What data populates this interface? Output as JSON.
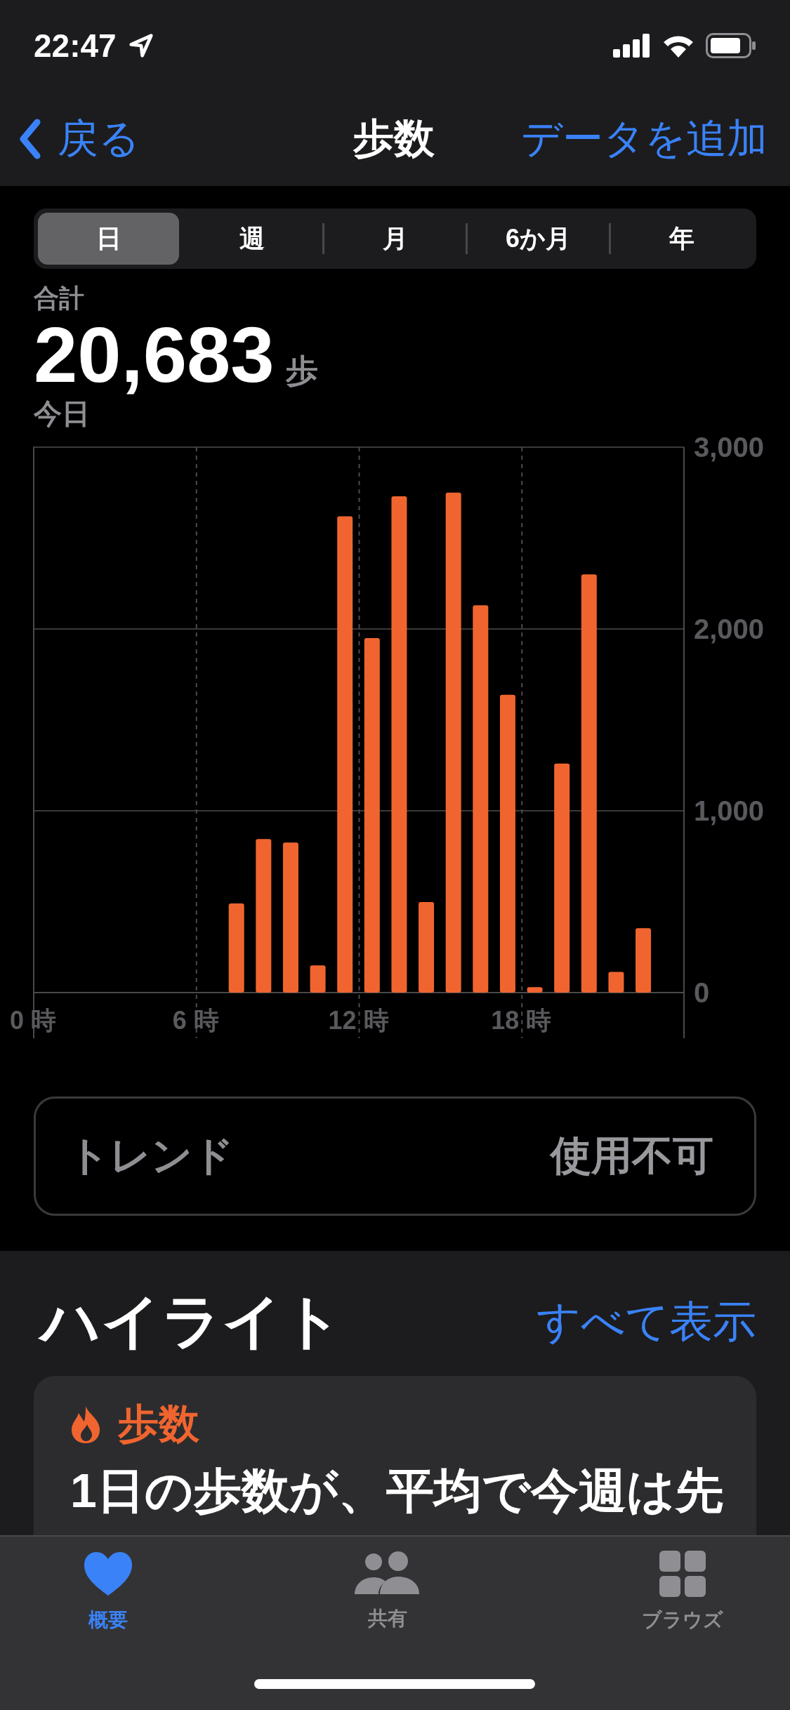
{
  "status_bar": {
    "time": "22:47"
  },
  "nav_bar": {
    "back": "戻る",
    "title": "歩数",
    "action": "データを追加"
  },
  "segments": [
    {
      "label": "日",
      "selected": true
    },
    {
      "label": "週",
      "selected": false
    },
    {
      "label": "月",
      "selected": false
    },
    {
      "label": "6か月",
      "selected": false
    },
    {
      "label": "年",
      "selected": false
    }
  ],
  "summary": {
    "label": "合計",
    "value": "20,683",
    "unit": "歩",
    "period": "今日"
  },
  "chart_data": {
    "type": "bar",
    "grid": true,
    "x": [
      7.5,
      8.5,
      9.5,
      10.5,
      11.5,
      12.5,
      13.5,
      14.5,
      15.5,
      16.5,
      17.5,
      18.5,
      19.5,
      20.5,
      21.5,
      22.5
    ],
    "series": [
      {
        "color": "#f0652f",
        "values": [
          490,
          845,
          825,
          150,
          2620,
          1950,
          2730,
          498,
          2750,
          2130,
          1638,
          30,
          1260,
          2300,
          114,
          354
        ]
      }
    ],
    "xlim": [
      0,
      24
    ],
    "ylim": [
      0,
      3000
    ],
    "xticks": [
      {
        "value": 0,
        "label": "0 時"
      },
      {
        "value": 6,
        "label": "6 時"
      },
      {
        "value": 12,
        "label": "12 時"
      },
      {
        "value": 18,
        "label": "18 時"
      }
    ],
    "yticks": [
      0,
      {
        "value": 1000,
        "label": "1,000"
      },
      {
        "value": 2000,
        "label": "2,000"
      },
      {
        "value": 3000,
        "label": "3,000"
      }
    ]
  },
  "trend": {
    "label": "トレンド",
    "value": "使用不可"
  },
  "highlights": {
    "title": "ハイライト",
    "link": "すべて表示",
    "card": {
      "title": "歩数",
      "text": "1日の歩数が、平均で今週は先"
    }
  },
  "tabs": [
    {
      "label": "概要",
      "selected": true
    },
    {
      "label": "共有",
      "selected": false
    },
    {
      "label": "ブラウズ",
      "selected": false
    }
  ]
}
